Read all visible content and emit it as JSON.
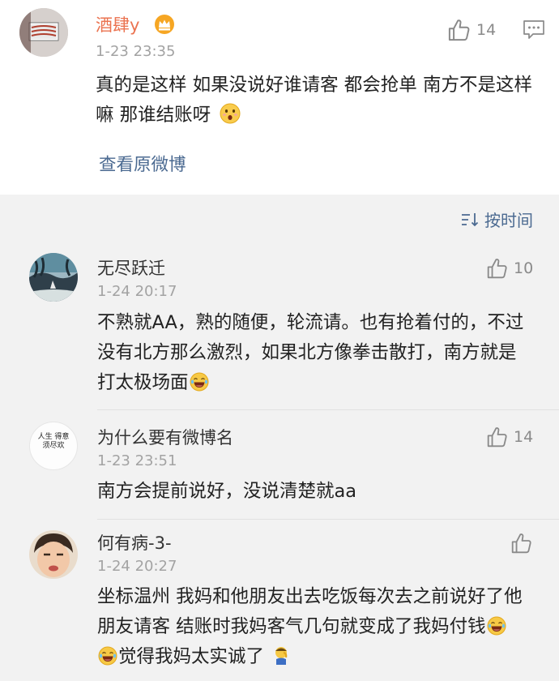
{
  "post": {
    "author": "酒肆y",
    "time": "1-23 23:35",
    "text": "真的是这样 如果没说好谁请客 都会抢单 南方不是这样嘛 那谁结账呀",
    "like_count": "14",
    "view_original": "查看原微博"
  },
  "sort": {
    "label": "按时间"
  },
  "comments": [
    {
      "author": "无尽跃迁",
      "time": "1-24 20:17",
      "likes": "10",
      "text": "不熟就AA，熟的随便，轮流请。也有抢着付的，不过没有北方那么激烈，如果北方像拳击散打，南方就是打太极场面"
    },
    {
      "author": "为什么要有微博名",
      "time": "1-23 23:51",
      "likes": "14",
      "avatar_text": "人生 得意 须尽欢",
      "text": "南方会提前说好，没说清楚就aa"
    },
    {
      "author": "何有病-3-",
      "time": "1-24 20:27",
      "likes": "",
      "text_a": "坐标温州 我妈和他朋友出去吃饭每次去之前说好了他朋友请客 结账时我妈客气几句就变成了我妈付钱",
      "text_b": "觉得我妈太实诚了"
    }
  ],
  "colors": {
    "author": "#eb7350",
    "link": "#4b6a91",
    "bg": "#f2f2f2"
  }
}
